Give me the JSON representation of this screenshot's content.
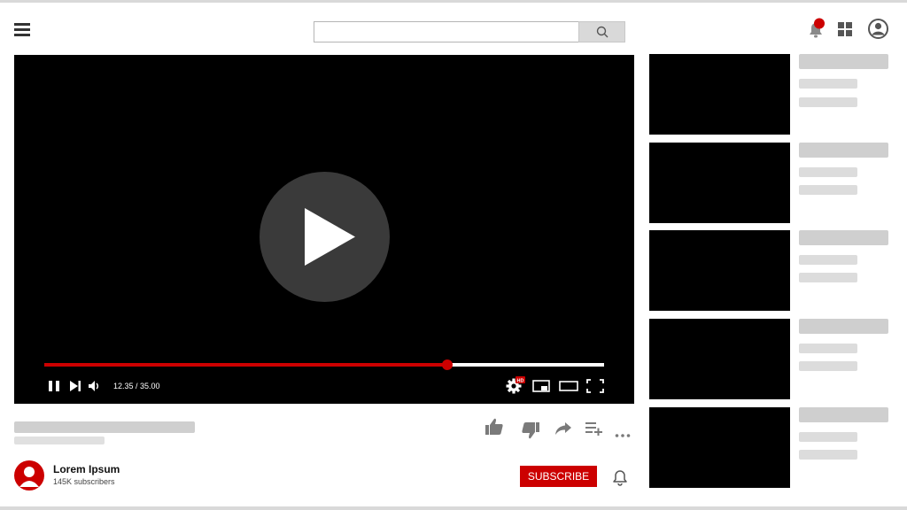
{
  "header": {
    "menu_icon": "hamburger-icon",
    "search": {
      "placeholder": "",
      "value": "",
      "button_icon": "search-icon"
    },
    "notifications_icon": "bell-icon",
    "apps_icon": "apps-grid-icon",
    "account_icon": "account-icon"
  },
  "player": {
    "center_icon": "play-icon",
    "progress_fraction": 0.72,
    "time": "12.35 / 35.00",
    "controls": [
      "pause-icon",
      "next-icon",
      "volume-icon",
      "settings-icon",
      "miniplayer-icon",
      "theater-mode-icon",
      "fullscreen-icon"
    ],
    "settings_badge": "HD"
  },
  "actions": [
    "thumbs-up-icon",
    "thumbs-down-icon",
    "share-icon",
    "add-to-playlist-icon",
    "more-icon"
  ],
  "channel": {
    "name": "Lorem Ipsum",
    "subscribers": "145K  subscribers",
    "subscribe_label": "SUBSCRIBE",
    "bell_icon": "bell-icon"
  },
  "recommendations_count": 5,
  "colors": {
    "accent": "#cc0000",
    "placeholder": "#cfcfcf",
    "player_bg": "#000000"
  }
}
